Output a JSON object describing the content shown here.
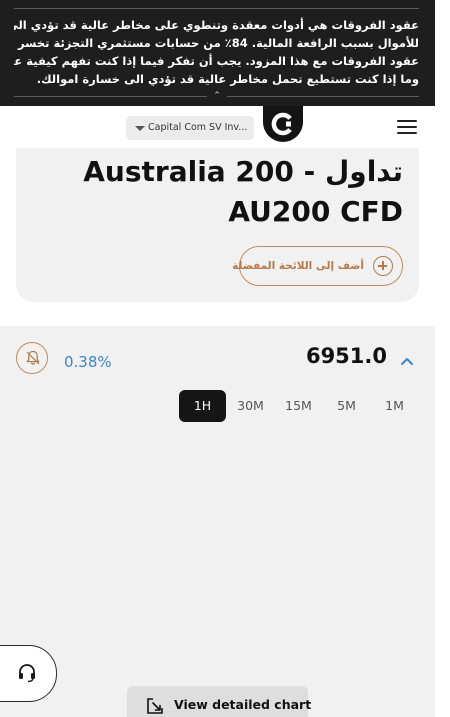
{
  "risk_warning": {
    "lines": [
      "عقود الفروقات هي أدوات معقدة وتنطوي على مخاطر عالية قد تؤدي الى خسارة سريعة",
      "للأموال بسبب الرافعة المالية. 84٪ من حسابات مستثمري التجزئة تخسر المال عند تداول",
      "عقود الفروقات مع هذا المزود. يجب أن تفكر فيما إذا كنت تفهم كيفية عمل عقود الفروقات",
      "وما إذا كنت تستطيع تحمل مخاطر عالية قد تؤدي الى خسارة اموالك."
    ],
    "collapse_icon": "double-chevron-up-icon"
  },
  "header": {
    "entity_select": "Capital Com SV Inv...",
    "logo_icon": "capital-com-logo",
    "menu_icon": "hamburger-menu-icon"
  },
  "instrument": {
    "title_line1": "تداول - Australia 200",
    "title_line2": "AU200 CFD",
    "watchlist_label": "أضف إلى اللائحة المفضلة",
    "watchlist_icon": "plus-circle-icon"
  },
  "quote": {
    "alert_icon": "bell-icon",
    "change": "0.38%",
    "price": "6951.0",
    "expand_icon": "chevron-up-icon"
  },
  "timeframes": [
    {
      "label": "1H",
      "active": true
    },
    {
      "label": "30M",
      "active": false
    },
    {
      "label": "15M",
      "active": false
    },
    {
      "label": "5M",
      "active": false
    },
    {
      "label": "1M",
      "active": false
    }
  ],
  "support": {
    "icon": "headset-icon"
  },
  "detail_chart": {
    "label": "View detailed chart",
    "icon": "expand-arrow-icon"
  },
  "colors": {
    "banner_bg": "#1e1e1e",
    "accent_copper": "#b57a4c",
    "change_blue": "#3f86c8",
    "panel_bg": "#f1f1f1"
  }
}
